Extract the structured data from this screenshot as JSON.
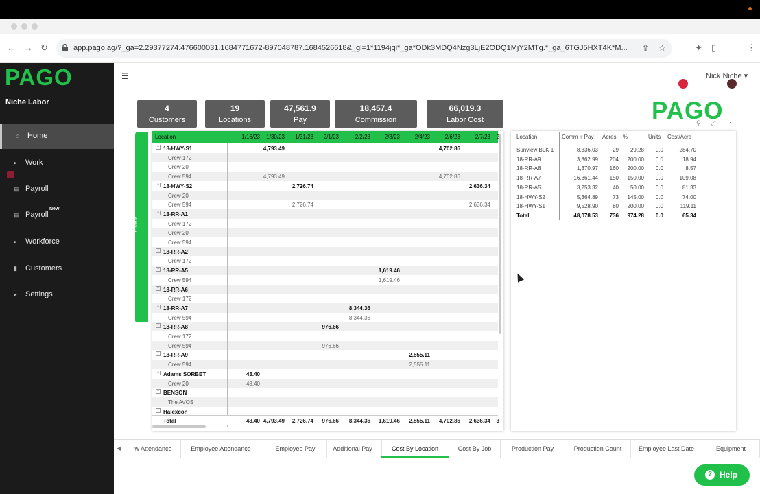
{
  "browser": {
    "url": "app.pago.ag/?_ga=2.29377274.476600031.1684771672-897048787.1684526618&_gl=1*1194jqi*_ga*ODk3MDQ4Nzg3LjE2ODQ1MjY2MTg.*_ga_6TGJ5HXT4K*M..."
  },
  "sidebar": {
    "logo": "PAGO",
    "company": "Niche Labor",
    "items": [
      {
        "label": "Home",
        "icon": "home-icon"
      },
      {
        "label": "Work",
        "icon": "caret-right-icon"
      },
      {
        "label": "Payroll",
        "icon": "payroll-icon"
      },
      {
        "label": "Payroll",
        "icon": "payroll-icon",
        "badge": "New"
      },
      {
        "label": "Workforce",
        "icon": "caret-right-icon"
      },
      {
        "label": "Customers",
        "icon": "customers-icon"
      },
      {
        "label": "Settings",
        "icon": "caret-right-icon"
      }
    ]
  },
  "header": {
    "user": "Nick Niche ▾"
  },
  "kpis": [
    {
      "value": "4",
      "label": "Customers"
    },
    {
      "value": "19",
      "label": "Locations"
    },
    {
      "value": "47,561.9",
      "label": "Pay"
    },
    {
      "value": "18,457.4",
      "label": "Commission"
    },
    {
      "value": "66,019.3",
      "label": "Labor Cost"
    }
  ],
  "report_logo": "PAGO",
  "filters_label": "Filters",
  "matrix": {
    "location_header": "Location",
    "dates": [
      "1/16/23",
      "1/30/23",
      "1/31/23",
      "2/1/23",
      "2/2/23",
      "2/3/23",
      "2/4/23",
      "2/6/23",
      "2/7/23",
      "2"
    ],
    "rows": [
      {
        "type": "parent",
        "label": "18-HWY-S1",
        "values": {
          "1": "4,793.49",
          "7": "4,702.86"
        }
      },
      {
        "type": "child",
        "label": "Crew 172",
        "values": {}
      },
      {
        "type": "child",
        "label": "Crew 20",
        "values": {}
      },
      {
        "type": "child",
        "label": "Crew 594",
        "values": {
          "1": "4,793.49",
          "7": "4,702.86"
        }
      },
      {
        "type": "parent",
        "label": "18-HWY-S2",
        "values": {
          "2": "2,726.74",
          "8": "2,636.34"
        }
      },
      {
        "type": "child",
        "label": "Crew 20",
        "values": {}
      },
      {
        "type": "child",
        "label": "Crew 594",
        "values": {
          "2": "2,726.74",
          "8": "2,636.34"
        }
      },
      {
        "type": "parent",
        "label": "18-RR-A1",
        "values": {}
      },
      {
        "type": "child",
        "label": "Crew 172",
        "values": {}
      },
      {
        "type": "child",
        "label": "Crew 20",
        "values": {}
      },
      {
        "type": "child",
        "label": "Crew 594",
        "values": {}
      },
      {
        "type": "parent",
        "label": "18-RR-A2",
        "values": {}
      },
      {
        "type": "child",
        "label": "Crew 172",
        "values": {}
      },
      {
        "type": "parent",
        "label": "18-RR-A5",
        "values": {
          "5": "1,619.46"
        }
      },
      {
        "type": "child",
        "label": "Crew 594",
        "values": {
          "5": "1,619.46"
        }
      },
      {
        "type": "parent",
        "label": "18-RR-A6",
        "values": {}
      },
      {
        "type": "child",
        "label": "Crew 172",
        "values": {}
      },
      {
        "type": "parent",
        "label": "18-RR-A7",
        "values": {
          "4": "8,344.36"
        }
      },
      {
        "type": "child",
        "label": "Crew 594",
        "values": {
          "4": "8,344.36"
        }
      },
      {
        "type": "parent",
        "label": "18-RR-A8",
        "values": {
          "3": "976.66"
        }
      },
      {
        "type": "child",
        "label": "Crew 172",
        "values": {}
      },
      {
        "type": "child",
        "label": "Crew 594",
        "values": {
          "3": "976.66"
        }
      },
      {
        "type": "parent",
        "label": "18-RR-A9",
        "values": {
          "6": "2,555.11"
        }
      },
      {
        "type": "child",
        "label": "Crew 594",
        "values": {
          "6": "2,555.11"
        }
      },
      {
        "type": "parent",
        "label": "Adams SORBET",
        "values": {
          "0": "43.40"
        }
      },
      {
        "type": "child",
        "label": "Crew 20",
        "values": {
          "0": "43.40"
        }
      },
      {
        "type": "parent",
        "label": "BENSON",
        "values": {}
      },
      {
        "type": "child",
        "label": "The AVOS",
        "values": {}
      },
      {
        "type": "parent",
        "label": "Halexcon",
        "values": {}
      }
    ],
    "total_label": "Total",
    "totals": [
      "43.40",
      "4,793.49",
      "2,726.74",
      "976.66",
      "8,344.36",
      "1,619.46",
      "2,555.11",
      "4,702.86",
      "2,636.34",
      "3"
    ]
  },
  "cost_table": {
    "headers": [
      "Location",
      "Comm + Pay",
      "Acres",
      "%",
      "Units",
      "Cost/Acre"
    ],
    "rows": [
      [
        "Sunview BLK 1",
        "8,336.03",
        "29",
        "29.28",
        "0.0",
        "284.70"
      ],
      [
        "18-RR-A9",
        "3,862.99",
        "204",
        "200.00",
        "0.0",
        "18.94"
      ],
      [
        "18-RR-A8",
        "1,370.97",
        "160",
        "200.00",
        "0.0",
        "8.57"
      ],
      [
        "18-RR-A7",
        "16,361.44",
        "150",
        "150.00",
        "0.0",
        "109.08"
      ],
      [
        "18-RR-A5",
        "3,253.32",
        "40",
        "50.00",
        "0.0",
        "81.33"
      ],
      [
        "18-HWY-S2",
        "5,364.89",
        "73",
        "145.00",
        "0.0",
        "74.00"
      ],
      [
        "18-HWY-S1",
        "9,528.90",
        "80",
        "200.00",
        "0.0",
        "119.11"
      ]
    ],
    "total": [
      "Total",
      "48,078.53",
      "736",
      "974.28",
      "0.0",
      "65.34"
    ]
  },
  "report_tabs": [
    {
      "label": "w Attendance",
      "active": false
    },
    {
      "label": "Employee Attendance",
      "active": false
    },
    {
      "label": "Employee Pay",
      "active": false
    },
    {
      "label": "Additional Pay",
      "active": false
    },
    {
      "label": "Cost By Location",
      "active": true
    },
    {
      "label": "Cost By Job",
      "active": false
    },
    {
      "label": "Production Pay",
      "active": false
    },
    {
      "label": "Production Count",
      "active": false
    },
    {
      "label": "Employee Last Date",
      "active": false
    },
    {
      "label": "Equipment",
      "active": false
    }
  ],
  "help_label": "Help",
  "colors": {
    "brand": "#21c04b",
    "sidebar": "#1b1b1b",
    "kpi": "#5c5c5c"
  }
}
